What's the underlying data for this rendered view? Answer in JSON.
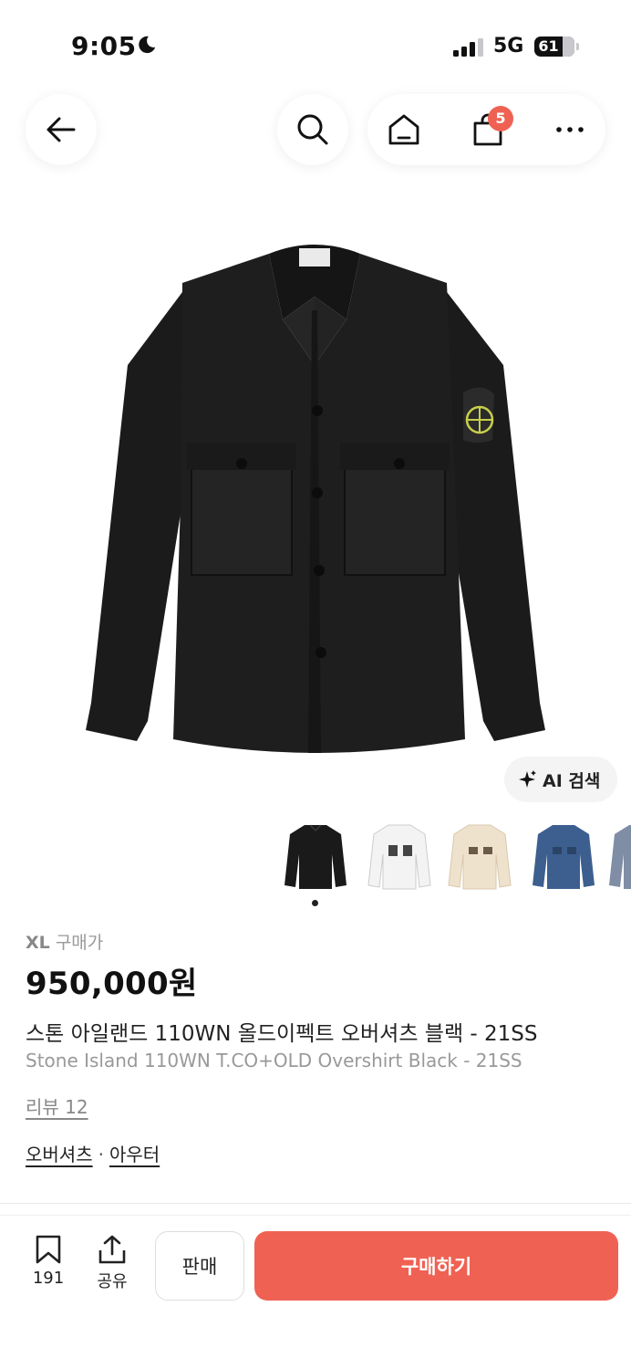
{
  "status_bar": {
    "time": "9:05",
    "network": "5G",
    "battery": "61",
    "icons": [
      "moon-icon",
      "signal-icon",
      "battery-icon"
    ]
  },
  "nav": {
    "icons": [
      "back-arrow-icon",
      "search-icon",
      "home-icon",
      "shopping-bag-icon",
      "more-icon"
    ],
    "cart_count": "5"
  },
  "product": {
    "ai_search_label": "AI 검색",
    "thumbnails": [
      "black",
      "white",
      "beige",
      "blue",
      "gray"
    ],
    "selected_thumbnail": 0,
    "size": "XL",
    "price_label": "구매가",
    "price": "950,000원",
    "title_ko": "스톤 아일랜드 110WN 올드이펙트 오버셔츠 블랙 - 21SS",
    "title_en": "Stone Island 110WN T.CO+OLD Overshirt Black - 21SS",
    "review": "리뷰 12",
    "categories": [
      "오버셔츠",
      "아우터"
    ],
    "category_separator": "·"
  },
  "bottom_bar": {
    "bookmark_count": "191",
    "share_label": "공유",
    "sell_label": "판매",
    "buy_label": "구매하기"
  },
  "colors": {
    "accent": "#ef6253",
    "thumb_black": "#1a1a1a",
    "thumb_white": "#f3f3f3",
    "thumb_beige": "#efe2cc",
    "thumb_blue": "#3d5f8f",
    "thumb_gray": "#7f8ea5"
  }
}
